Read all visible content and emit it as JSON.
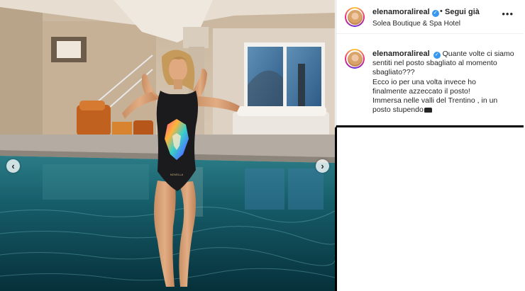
{
  "post": {
    "username": "elenamoralireal",
    "follow_separator": "•",
    "follow_label": "Segui già",
    "location": "Solea Boutique & Spa Hotel",
    "more_icon": "more-options-icon",
    "verified_icon": "verified-badge-icon"
  },
  "caption": {
    "username": "elenamoralireal",
    "lines": [
      "Quante volte ci siamo",
      "sentiti nel posto sbagliato al momento",
      "sbagliato???",
      "Ecco io per una volta invece ho",
      "finalmente azzeccato il posto!",
      "Immersa nelle valli del Trentino , in un",
      "posto stupendo"
    ]
  },
  "media": {
    "swimsuit_print": "NOVELLA",
    "prev_icon": "chevron-left-icon",
    "next_icon": "chevron-right-icon"
  },
  "colors": {
    "text": "#262626",
    "verified": "#3897f0",
    "water": "#0c4653",
    "divider": "#000000"
  }
}
